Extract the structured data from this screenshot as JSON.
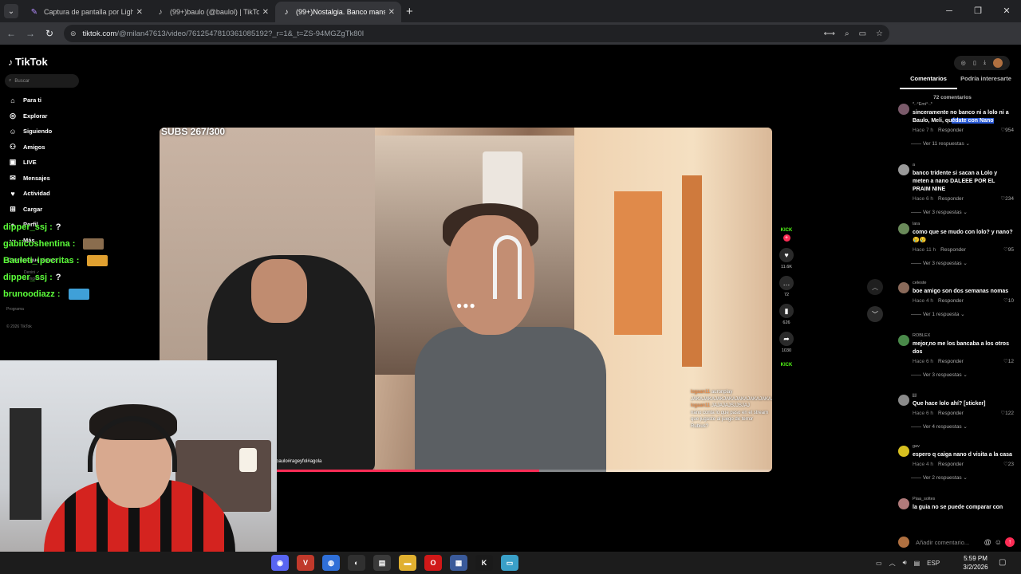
{
  "browser": {
    "tabs": [
      {
        "label": "Captura de pantalla por Lightsh",
        "active": false
      },
      {
        "label": "(99+)baulo (@baulol) | TikTok",
        "active": false
      },
      {
        "label": "(99+)Nostalgia. Banco mansion",
        "active": true
      }
    ],
    "url_host": "tiktok.com",
    "url_path": "/@milan47613/video/7612547810361085192?_r=1&_t=ZS-94MGZgTk80l",
    "profile_initial": "B"
  },
  "tiktok": {
    "logo": "TikTok",
    "search_placeholder": "Buscar",
    "nav": [
      {
        "icon": "home-icon",
        "glyph": "⌂",
        "label": "Para ti"
      },
      {
        "icon": "compass-icon",
        "glyph": "◎",
        "label": "Explorar"
      },
      {
        "icon": "following-icon",
        "glyph": "☺",
        "label": "Siguiendo"
      },
      {
        "icon": "friends-icon",
        "glyph": "⚇",
        "label": "Amigos"
      },
      {
        "icon": "live-icon",
        "glyph": "▣",
        "label": "LIVE"
      },
      {
        "icon": "messages-icon",
        "glyph": "✉",
        "label": "Mensajes"
      },
      {
        "icon": "activity-icon",
        "glyph": "♥",
        "label": "Actividad"
      },
      {
        "icon": "upload-icon",
        "glyph": "⊞",
        "label": "Cargar"
      },
      {
        "icon": "profile-icon",
        "glyph": "●",
        "label": "Perfil"
      },
      {
        "icon": "more-icon",
        "glyph": "⋯",
        "label": "Más"
      }
    ],
    "following_title": "Cuentas que sigues",
    "faded_texts": [
      "Denini ✓",
      "Reingreso",
      "Programa",
      "© 2026 TikTok"
    ]
  },
  "stream_chat": [
    {
      "user": "dipper_ssj :",
      "message": "?",
      "emote": false
    },
    {
      "user": "gabiicoshentina :",
      "message": "",
      "emote": true,
      "emote_color": "#8a6d4e"
    },
    {
      "user": "Bauleti_ipocritas :",
      "message": "",
      "emote": true,
      "emote_color": "#e0a030"
    },
    {
      "user": "dipper_ssj :",
      "message": "?",
      "emote": false
    },
    {
      "user": "brunoodiazz :",
      "message": "",
      "emote": true,
      "emote_color": "#3fa0d8"
    }
  ],
  "video": {
    "subs_text": "SUBS 267/300",
    "tag_text": "baulo#rageyfol#agola",
    "progress": 0.62,
    "chat_lines": [
      {
        "name": "logaan11",
        "msg": "auronplay"
      },
      {
        "name": "",
        "msg": "JAKAJAKAJAKJAKAJAKAJAKAJAKAJAKAJA"
      },
      {
        "name": "logaan11",
        "msg": "JAJAJAJSJJSJAJ"
      },
      {
        "name": "",
        "msg": "nano conta lo que paso en el stream que jugaste al juego de terror"
      },
      {
        "name": "",
        "msg": "Rubius?"
      }
    ]
  },
  "actions": {
    "kick_label": "KICK",
    "likes": "11.6K",
    "comments": "72",
    "saves": "626",
    "shares": "1030"
  },
  "comments_panel": {
    "tabs": [
      "Comentarios",
      "Podría interesarte"
    ],
    "count_label": "72 comentarios",
    "add_placeholder": "Añadir comentario...",
    "items": [
      {
        "user": "*.·°Emi°·.*",
        "text_before": "sinceramente no banco ni a lolo ni a Baulo, Meli, qu",
        "text_highlight": "édate con Nano",
        "time": "Hace 7 h",
        "reply": "Responder",
        "likes": "954",
        "replies": "Ver 11 respuestas",
        "avatar_color": "#7a5a6a"
      },
      {
        "user": "a",
        "text_before": "banco tridente si sacan a Lolo y meten a nano DALEEE POR EL PRAIM NINE",
        "text_highlight": "",
        "time": "Hace 6 h",
        "reply": "Responder",
        "likes": "234",
        "replies": "Ver 3 respuestas",
        "avatar_color": "#9a9a9a"
      },
      {
        "user": "lara",
        "text_before": "como que se mudo con lolo? y nano? 😢😢",
        "text_highlight": "",
        "time": "Hace 11 h",
        "reply": "Responder",
        "likes": "95",
        "replies": "Ver 3 respuestas",
        "avatar_color": "#6a8a5a"
      },
      {
        "user": "celeste",
        "text_before": "boe amigo son dos semanas nomas",
        "text_highlight": "",
        "time": "Hace 4 h",
        "reply": "Responder",
        "likes": "10",
        "replies": "Ver 1 respuesta",
        "avatar_color": "#8a6a5a"
      },
      {
        "user": "ROBLEX",
        "text_before": "mejor,no me los bancaba a los otros dos",
        "text_highlight": "",
        "time": "Hace 6 h",
        "reply": "Responder",
        "likes": "12",
        "replies": "Ver 3 respuestas",
        "avatar_color": "#4a8a4a"
      },
      {
        "user": "jjjj",
        "text_before": "Que hace lolo ahí? [sticker]",
        "text_highlight": "",
        "time": "Hace 6 h",
        "reply": "Responder",
        "likes": "122",
        "replies": "Ver 4 respuestas",
        "avatar_color": "#8a8a8a"
      },
      {
        "user": "gav",
        "text_before": "espero q caiga nano d visita a la casa",
        "text_highlight": "",
        "time": "Hace 4 h",
        "reply": "Responder",
        "likes": "23",
        "replies": "Ver 2 respuestas",
        "avatar_color": "#d8c020"
      },
      {
        "user": "Piaa_soltes",
        "text_before": "la guia no se puede comparar con",
        "text_highlight": "",
        "time": "",
        "reply": "",
        "likes": "",
        "replies": "",
        "avatar_color": "#b07a7a"
      }
    ]
  },
  "taskbar": {
    "apps": [
      {
        "name": "discord-app-icon",
        "glyph": "◉",
        "color": "#5865f2"
      },
      {
        "name": "voice-app-icon",
        "glyph": "V",
        "color": "#c0392b"
      },
      {
        "name": "chrome-app-icon",
        "glyph": "◍",
        "color": "#2f6fd8"
      },
      {
        "name": "obs-app-icon",
        "glyph": "◐",
        "color": "#303030"
      },
      {
        "name": "game-app-icon",
        "glyph": "▤",
        "color": "#3a3a3a"
      },
      {
        "name": "folder-app-icon",
        "glyph": "▬",
        "color": "#e0b030"
      },
      {
        "name": "opera-app-icon",
        "glyph": "O",
        "color": "#d01818"
      },
      {
        "name": "settings-app-icon",
        "glyph": "▦",
        "color": "#3a5a9a"
      },
      {
        "name": "kick-app-icon",
        "glyph": "K",
        "color": "#1a1a1a"
      },
      {
        "name": "notes-app-icon",
        "glyph": "▭",
        "color": "#3aa0c8"
      }
    ],
    "lang": "ESP",
    "time": "5:59 PM",
    "date": "3/2/2026"
  }
}
